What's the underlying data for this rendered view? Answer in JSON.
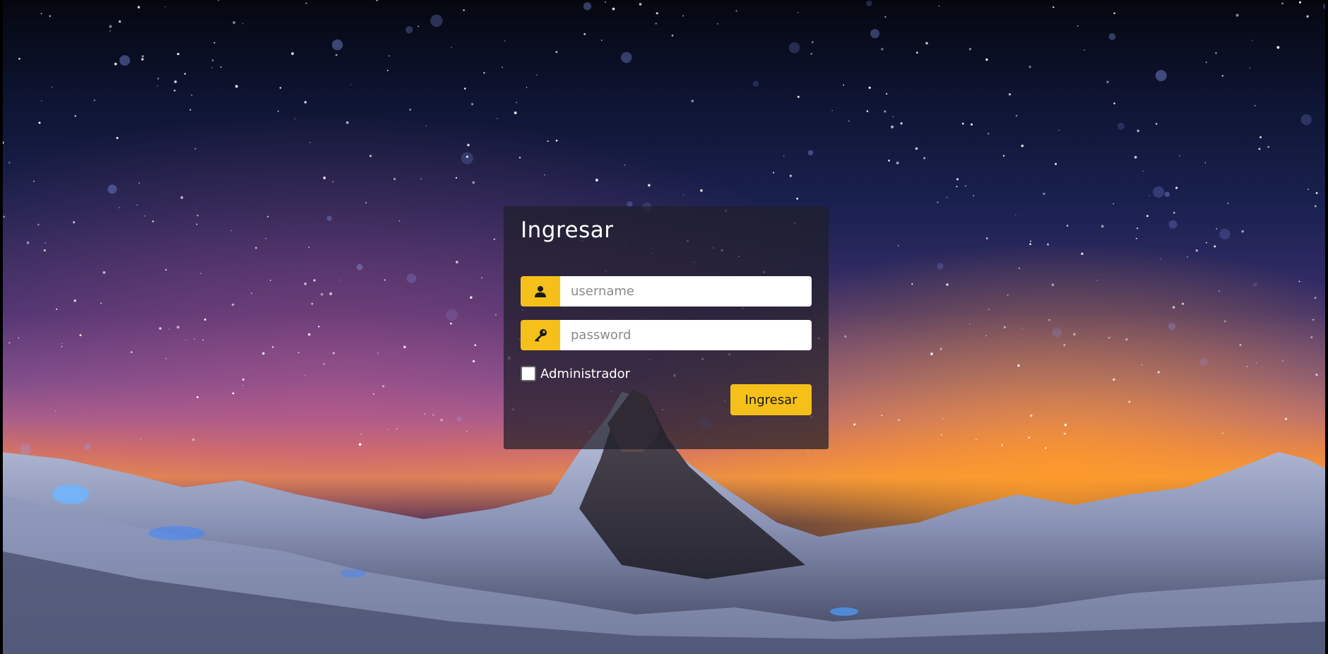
{
  "login": {
    "title": "Ingresar",
    "username": {
      "placeholder": "username",
      "value": "",
      "icon": "user-icon"
    },
    "password": {
      "placeholder": "password",
      "value": "",
      "icon": "key-icon"
    },
    "admin_checkbox": {
      "label": "Administrador",
      "checked": false
    },
    "submit_label": "Ingresar"
  },
  "colors": {
    "accent": "#f5c01a",
    "card_background": "rgba(30,30,42,0.72)",
    "input_background": "#ffffff",
    "title_text": "#ffffff"
  }
}
